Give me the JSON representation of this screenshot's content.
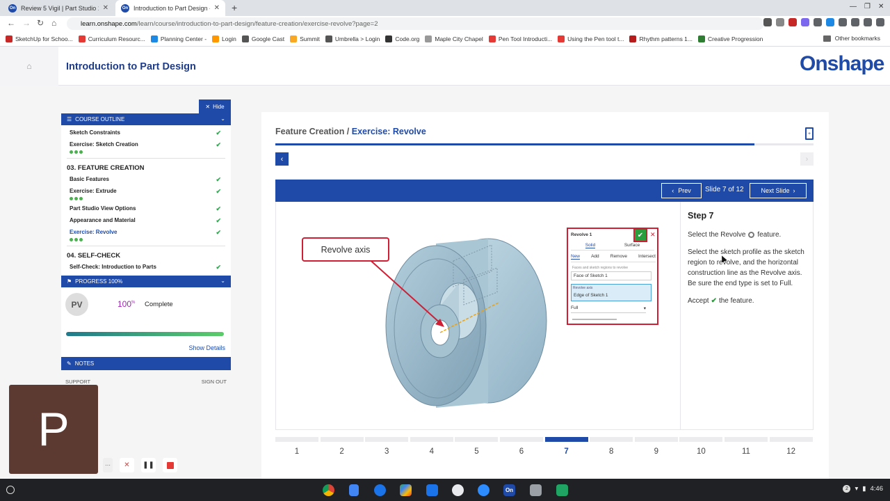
{
  "browser": {
    "tabs": [
      {
        "title": "Review 5 Vigil | Part Studio 1",
        "active": false
      },
      {
        "title": "Introduction to Part Design - Exercise: Revolve",
        "active": true
      }
    ],
    "url_host": "learn.onshape.com",
    "url_path": "/learn/course/introduction-to-part-design/feature-creation/exercise-revolve?page=2",
    "bookmarks": [
      {
        "label": "SketchUp for Schoo...",
        "color": "#c62828"
      },
      {
        "label": "Curriculum Resourc...",
        "color": "#e53935"
      },
      {
        "label": "Planning Center -",
        "color": "#1e88e5"
      },
      {
        "label": "Login",
        "color": "#ff9800"
      },
      {
        "label": "Google Cast",
        "color": "#555555"
      },
      {
        "label": "Summit",
        "color": "#f9a825"
      },
      {
        "label": "Umbrella > Login",
        "color": "#555555"
      },
      {
        "label": "Code.org",
        "color": "#333333"
      },
      {
        "label": "Maple City Chapel",
        "color": "#999999"
      },
      {
        "label": "Pen Tool Introducti...",
        "color": "#e53935"
      },
      {
        "label": "Using the Pen tool t...",
        "color": "#e53935"
      },
      {
        "label": "Rhythm patterns 1...",
        "color": "#b71c1c"
      },
      {
        "label": "Creative Progression",
        "color": "#2e7d32"
      }
    ],
    "other_bookmarks": "Other bookmarks"
  },
  "header": {
    "course_title": "Introduction to Part Design",
    "logo": "Onshape"
  },
  "sidebar": {
    "hide_label": "Hide",
    "outline_title": "COURSE OUTLINE",
    "top_items": [
      {
        "label": "Sketch Constraints",
        "dots": false
      },
      {
        "label": "Exercise: Sketch Creation",
        "dots": true
      }
    ],
    "chapter3": "03. FEATURE CREATION",
    "chapter3_items": [
      {
        "label": "Basic Features",
        "dots": false
      },
      {
        "label": "Exercise: Extrude",
        "dots": true
      },
      {
        "label": "Part Studio View Options",
        "dots": false
      },
      {
        "label": "Appearance and Material",
        "dots": false
      },
      {
        "label": "Exercise: Revolve",
        "dots": true,
        "active": true
      }
    ],
    "chapter4": "04. SELF-CHECK",
    "chapter4_items": [
      {
        "label": "Self-Check: Introduction to Parts",
        "dots": false
      }
    ],
    "progress_title": "PROGRESS 100%",
    "avatar_initials": "PV",
    "progress_pct": "100",
    "progress_sup": "%",
    "complete_label": "Complete",
    "progress_value": 1.0,
    "show_details": "Show Details",
    "notes_title": "NOTES",
    "support": "SUPPORT",
    "sign_out": "SIGN OUT"
  },
  "content": {
    "crumb_parent": "Feature Creation /",
    "crumb_current": "Exercise: Revolve",
    "lesson_progress": 0.89,
    "prev_label": "Prev",
    "next_label": "Next Slide",
    "slide_counter": "Slide 7 of 12",
    "step_title": "Step 7",
    "step_p1_a": "Select the Revolve",
    "step_p1_b": "feature.",
    "step_p2": "Select the sketch profile as the sketch region to revolve, and the horizontal construction line as the Revolve axis. Be sure the end type is set to Full.",
    "step_p3_a": "Accept",
    "step_p3_b": "the feature.",
    "callout": "Revolve axis",
    "panel": {
      "title": "Revolve 1",
      "tab_solid": "Solid",
      "tab_surface": "Surface",
      "mode_new": "New",
      "mode_add": "Add",
      "mode_remove": "Remove",
      "mode_intersect": "Intersect",
      "faces_label": "Faces and sketch regions to revolve",
      "faces_value": "Face of Sketch 1",
      "axis_label": "Revolve axis",
      "axis_value": "Edge of Sketch 1",
      "end_type": "Full"
    },
    "pages": [
      "1",
      "2",
      "3",
      "4",
      "5",
      "6",
      "7",
      "8",
      "9",
      "10",
      "11",
      "12"
    ],
    "current_page": 7
  },
  "webcam_letter": "P",
  "clock": "4:46",
  "notif_count": "2",
  "colors": {
    "brand": "#1f4aa8",
    "accent_red": "#cf1f34",
    "check_green": "#2a9d3c"
  }
}
